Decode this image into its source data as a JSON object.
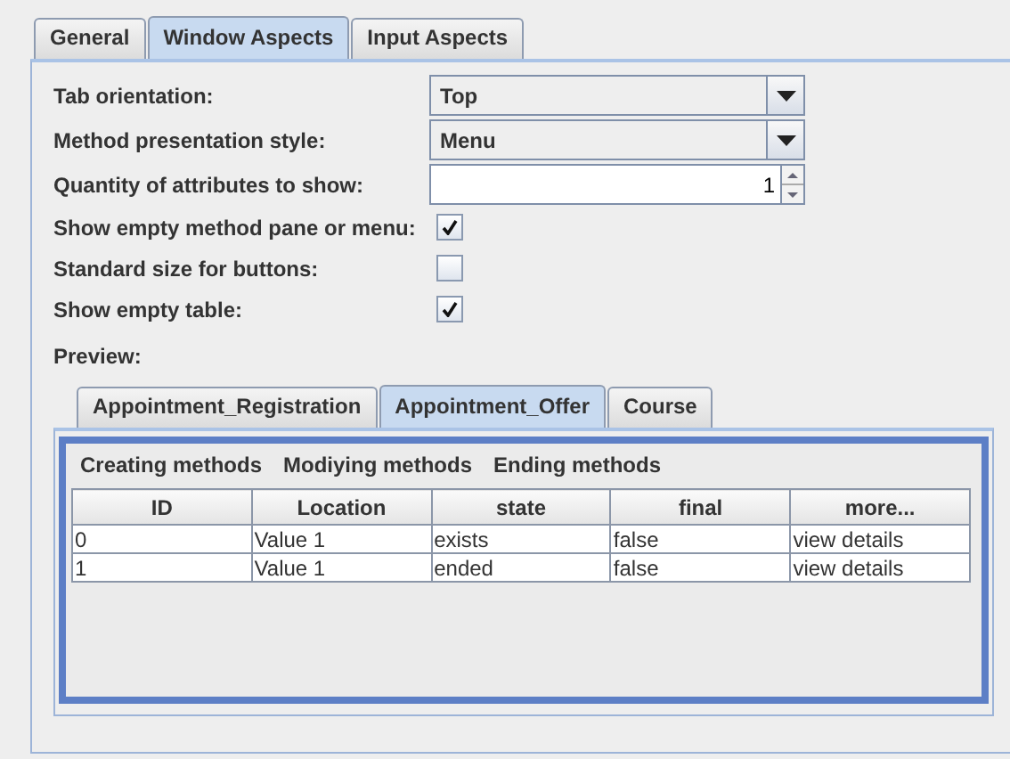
{
  "tabs": [
    {
      "label": "General",
      "selected": false
    },
    {
      "label": "Window Aspects",
      "selected": true
    },
    {
      "label": "Input Aspects",
      "selected": false
    }
  ],
  "settings": [
    {
      "kind": "combo",
      "label": "Tab orientation:",
      "value": "Top"
    },
    {
      "kind": "combo",
      "label": "Method presentation style:",
      "value": "Menu"
    },
    {
      "kind": "spinner",
      "label": "Quantity of attributes to show:",
      "value": "1"
    },
    {
      "kind": "checkbox",
      "label": "Show empty method pane or menu:",
      "checked": true
    },
    {
      "kind": "checkbox",
      "label": "Standard size for buttons:",
      "checked": false
    },
    {
      "kind": "checkbox",
      "label": "Show empty table:",
      "checked": true
    }
  ],
  "preview": {
    "label": "Preview:",
    "tabs": [
      {
        "label": "Appointment_Registration",
        "selected": false
      },
      {
        "label": "Appointment_Offer",
        "selected": true
      },
      {
        "label": "Course",
        "selected": false
      }
    ],
    "menu": [
      "Creating methods",
      "Modiying methods",
      "Ending methods"
    ],
    "table": {
      "columns": [
        "ID",
        "Location",
        "state",
        "final",
        "more..."
      ],
      "rows": [
        [
          "0",
          "Value 1",
          "exists",
          "false",
          "view details"
        ],
        [
          "1",
          "Value 1",
          "ended",
          "false",
          "view details"
        ]
      ]
    }
  }
}
